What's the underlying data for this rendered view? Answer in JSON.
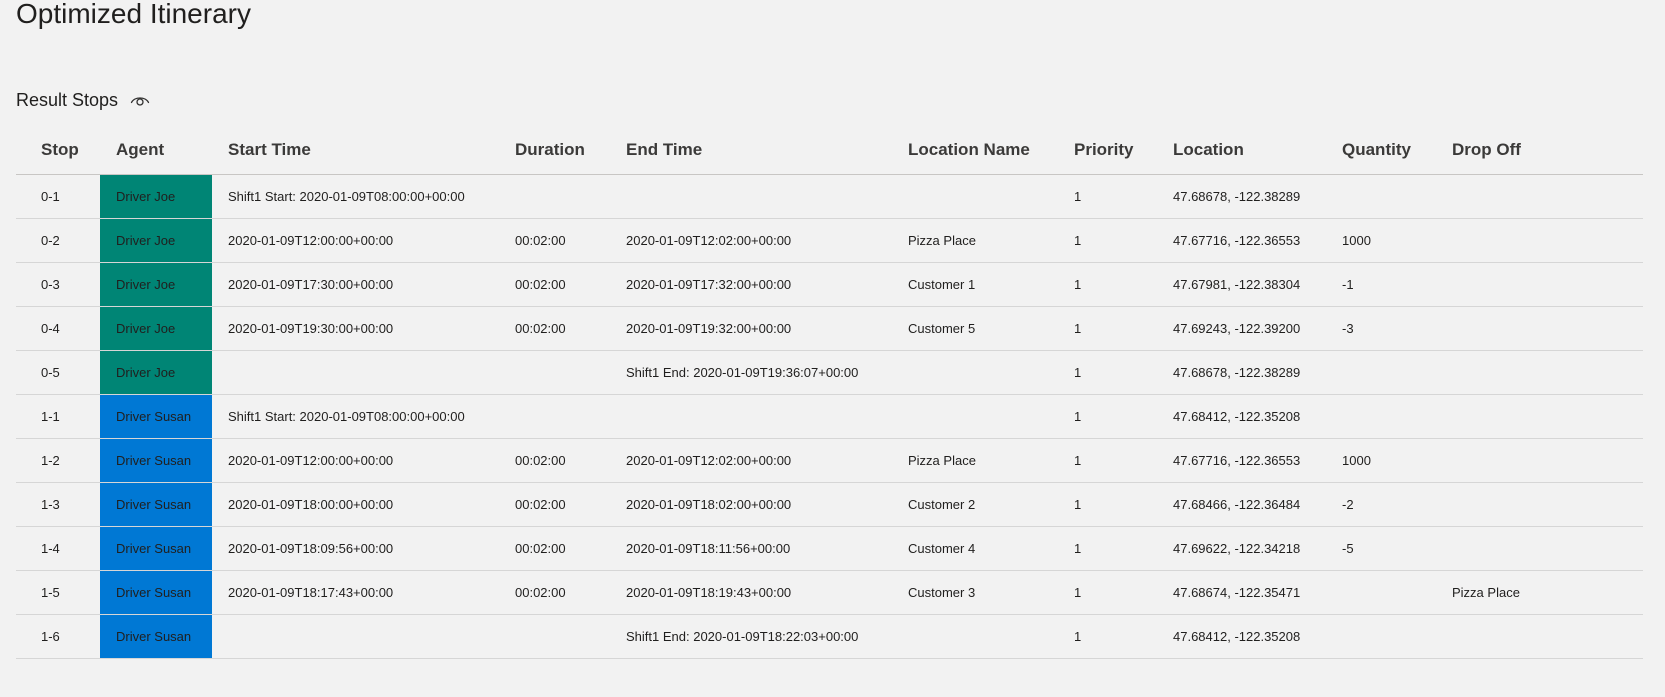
{
  "page": {
    "title": "Optimized Itinerary"
  },
  "section": {
    "title": "Result Stops",
    "toggle_icon": "eye-icon"
  },
  "colors": {
    "background": "#f2f2f2",
    "agent_joe": "#008575",
    "agent_susan": "#0078d4"
  },
  "table": {
    "columns": [
      "Stop",
      "Agent",
      "Start Time",
      "Duration",
      "End Time",
      "Location Name",
      "Priority",
      "Location",
      "Quantity",
      "Drop Off"
    ],
    "rows": [
      {
        "stop": "0-1",
        "agent": "Driver Joe",
        "agent_color": "#008575",
        "start_time": "Shift1 Start: 2020-01-09T08:00:00+00:00",
        "duration": "",
        "end_time": "",
        "location_name": "",
        "priority": "1",
        "location": "47.68678, -122.38289",
        "quantity": "",
        "drop_off": ""
      },
      {
        "stop": "0-2",
        "agent": "Driver Joe",
        "agent_color": "#008575",
        "start_time": "2020-01-09T12:00:00+00:00",
        "duration": "00:02:00",
        "end_time": "2020-01-09T12:02:00+00:00",
        "location_name": "Pizza Place",
        "priority": "1",
        "location": "47.67716, -122.36553",
        "quantity": "1000",
        "drop_off": ""
      },
      {
        "stop": "0-3",
        "agent": "Driver Joe",
        "agent_color": "#008575",
        "start_time": "2020-01-09T17:30:00+00:00",
        "duration": "00:02:00",
        "end_time": "2020-01-09T17:32:00+00:00",
        "location_name": "Customer 1",
        "priority": "1",
        "location": "47.67981, -122.38304",
        "quantity": "-1",
        "drop_off": ""
      },
      {
        "stop": "0-4",
        "agent": "Driver Joe",
        "agent_color": "#008575",
        "start_time": "2020-01-09T19:30:00+00:00",
        "duration": "00:02:00",
        "end_time": "2020-01-09T19:32:00+00:00",
        "location_name": "Customer 5",
        "priority": "1",
        "location": "47.69243, -122.39200",
        "quantity": "-3",
        "drop_off": ""
      },
      {
        "stop": "0-5",
        "agent": "Driver Joe",
        "agent_color": "#008575",
        "start_time": "",
        "duration": "",
        "end_time": "Shift1 End: 2020-01-09T19:36:07+00:00",
        "location_name": "",
        "priority": "1",
        "location": "47.68678, -122.38289",
        "quantity": "",
        "drop_off": ""
      },
      {
        "stop": "1-1",
        "agent": "Driver Susan",
        "agent_color": "#0078d4",
        "start_time": "Shift1 Start: 2020-01-09T08:00:00+00:00",
        "duration": "",
        "end_time": "",
        "location_name": "",
        "priority": "1",
        "location": "47.68412, -122.35208",
        "quantity": "",
        "drop_off": ""
      },
      {
        "stop": "1-2",
        "agent": "Driver Susan",
        "agent_color": "#0078d4",
        "start_time": "2020-01-09T12:00:00+00:00",
        "duration": "00:02:00",
        "end_time": "2020-01-09T12:02:00+00:00",
        "location_name": "Pizza Place",
        "priority": "1",
        "location": "47.67716, -122.36553",
        "quantity": "1000",
        "drop_off": ""
      },
      {
        "stop": "1-3",
        "agent": "Driver Susan",
        "agent_color": "#0078d4",
        "start_time": "2020-01-09T18:00:00+00:00",
        "duration": "00:02:00",
        "end_time": "2020-01-09T18:02:00+00:00",
        "location_name": "Customer 2",
        "priority": "1",
        "location": "47.68466, -122.36484",
        "quantity": "-2",
        "drop_off": ""
      },
      {
        "stop": "1-4",
        "agent": "Driver Susan",
        "agent_color": "#0078d4",
        "start_time": "2020-01-09T18:09:56+00:00",
        "duration": "00:02:00",
        "end_time": "2020-01-09T18:11:56+00:00",
        "location_name": "Customer 4",
        "priority": "1",
        "location": "47.69622, -122.34218",
        "quantity": "-5",
        "drop_off": ""
      },
      {
        "stop": "1-5",
        "agent": "Driver Susan",
        "agent_color": "#0078d4",
        "start_time": "2020-01-09T18:17:43+00:00",
        "duration": "00:02:00",
        "end_time": "2020-01-09T18:19:43+00:00",
        "location_name": "Customer 3",
        "priority": "1",
        "location": "47.68674, -122.35471",
        "quantity": "",
        "drop_off": "Pizza Place"
      },
      {
        "stop": "1-6",
        "agent": "Driver Susan",
        "agent_color": "#0078d4",
        "start_time": "",
        "duration": "",
        "end_time": "Shift1 End: 2020-01-09T18:22:03+00:00",
        "location_name": "",
        "priority": "1",
        "location": "47.68412, -122.35208",
        "quantity": "",
        "drop_off": ""
      }
    ]
  }
}
